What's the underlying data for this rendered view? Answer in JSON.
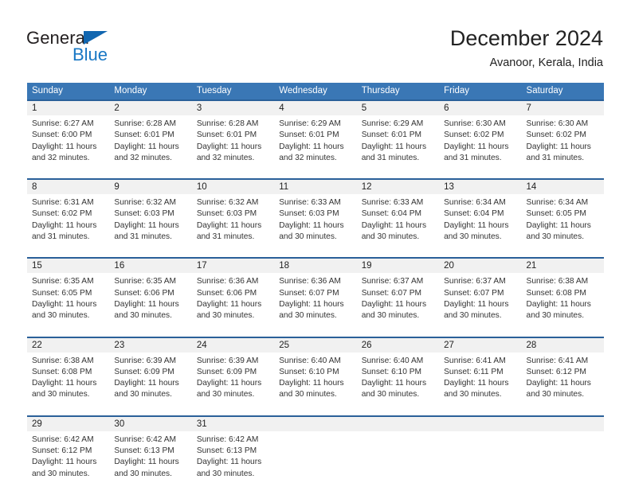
{
  "brand": {
    "name_top": "General",
    "name_bottom": "Blue",
    "triangle_color": "#1166b0",
    "blue_color": "#1877c4"
  },
  "header": {
    "title": "December 2024",
    "location": "Avanoor, Kerala, India"
  },
  "theme": {
    "header_blue": "#3a77b5",
    "row_border_blue": "#2a6099",
    "date_band_gray": "#f1f1f1"
  },
  "calendar": {
    "day_headers": [
      "Sunday",
      "Monday",
      "Tuesday",
      "Wednesday",
      "Thursday",
      "Friday",
      "Saturday"
    ],
    "weeks": [
      [
        {
          "day": "1",
          "sunrise": "Sunrise: 6:27 AM",
          "sunset": "Sunset: 6:00 PM",
          "daylight1": "Daylight: 11 hours",
          "daylight2": "and 32 minutes."
        },
        {
          "day": "2",
          "sunrise": "Sunrise: 6:28 AM",
          "sunset": "Sunset: 6:01 PM",
          "daylight1": "Daylight: 11 hours",
          "daylight2": "and 32 minutes."
        },
        {
          "day": "3",
          "sunrise": "Sunrise: 6:28 AM",
          "sunset": "Sunset: 6:01 PM",
          "daylight1": "Daylight: 11 hours",
          "daylight2": "and 32 minutes."
        },
        {
          "day": "4",
          "sunrise": "Sunrise: 6:29 AM",
          "sunset": "Sunset: 6:01 PM",
          "daylight1": "Daylight: 11 hours",
          "daylight2": "and 32 minutes."
        },
        {
          "day": "5",
          "sunrise": "Sunrise: 6:29 AM",
          "sunset": "Sunset: 6:01 PM",
          "daylight1": "Daylight: 11 hours",
          "daylight2": "and 31 minutes."
        },
        {
          "day": "6",
          "sunrise": "Sunrise: 6:30 AM",
          "sunset": "Sunset: 6:02 PM",
          "daylight1": "Daylight: 11 hours",
          "daylight2": "and 31 minutes."
        },
        {
          "day": "7",
          "sunrise": "Sunrise: 6:30 AM",
          "sunset": "Sunset: 6:02 PM",
          "daylight1": "Daylight: 11 hours",
          "daylight2": "and 31 minutes."
        }
      ],
      [
        {
          "day": "8",
          "sunrise": "Sunrise: 6:31 AM",
          "sunset": "Sunset: 6:02 PM",
          "daylight1": "Daylight: 11 hours",
          "daylight2": "and 31 minutes."
        },
        {
          "day": "9",
          "sunrise": "Sunrise: 6:32 AM",
          "sunset": "Sunset: 6:03 PM",
          "daylight1": "Daylight: 11 hours",
          "daylight2": "and 31 minutes."
        },
        {
          "day": "10",
          "sunrise": "Sunrise: 6:32 AM",
          "sunset": "Sunset: 6:03 PM",
          "daylight1": "Daylight: 11 hours",
          "daylight2": "and 31 minutes."
        },
        {
          "day": "11",
          "sunrise": "Sunrise: 6:33 AM",
          "sunset": "Sunset: 6:03 PM",
          "daylight1": "Daylight: 11 hours",
          "daylight2": "and 30 minutes."
        },
        {
          "day": "12",
          "sunrise": "Sunrise: 6:33 AM",
          "sunset": "Sunset: 6:04 PM",
          "daylight1": "Daylight: 11 hours",
          "daylight2": "and 30 minutes."
        },
        {
          "day": "13",
          "sunrise": "Sunrise: 6:34 AM",
          "sunset": "Sunset: 6:04 PM",
          "daylight1": "Daylight: 11 hours",
          "daylight2": "and 30 minutes."
        },
        {
          "day": "14",
          "sunrise": "Sunrise: 6:34 AM",
          "sunset": "Sunset: 6:05 PM",
          "daylight1": "Daylight: 11 hours",
          "daylight2": "and 30 minutes."
        }
      ],
      [
        {
          "day": "15",
          "sunrise": "Sunrise: 6:35 AM",
          "sunset": "Sunset: 6:05 PM",
          "daylight1": "Daylight: 11 hours",
          "daylight2": "and 30 minutes."
        },
        {
          "day": "16",
          "sunrise": "Sunrise: 6:35 AM",
          "sunset": "Sunset: 6:06 PM",
          "daylight1": "Daylight: 11 hours",
          "daylight2": "and 30 minutes."
        },
        {
          "day": "17",
          "sunrise": "Sunrise: 6:36 AM",
          "sunset": "Sunset: 6:06 PM",
          "daylight1": "Daylight: 11 hours",
          "daylight2": "and 30 minutes."
        },
        {
          "day": "18",
          "sunrise": "Sunrise: 6:36 AM",
          "sunset": "Sunset: 6:07 PM",
          "daylight1": "Daylight: 11 hours",
          "daylight2": "and 30 minutes."
        },
        {
          "day": "19",
          "sunrise": "Sunrise: 6:37 AM",
          "sunset": "Sunset: 6:07 PM",
          "daylight1": "Daylight: 11 hours",
          "daylight2": "and 30 minutes."
        },
        {
          "day": "20",
          "sunrise": "Sunrise: 6:37 AM",
          "sunset": "Sunset: 6:07 PM",
          "daylight1": "Daylight: 11 hours",
          "daylight2": "and 30 minutes."
        },
        {
          "day": "21",
          "sunrise": "Sunrise: 6:38 AM",
          "sunset": "Sunset: 6:08 PM",
          "daylight1": "Daylight: 11 hours",
          "daylight2": "and 30 minutes."
        }
      ],
      [
        {
          "day": "22",
          "sunrise": "Sunrise: 6:38 AM",
          "sunset": "Sunset: 6:08 PM",
          "daylight1": "Daylight: 11 hours",
          "daylight2": "and 30 minutes."
        },
        {
          "day": "23",
          "sunrise": "Sunrise: 6:39 AM",
          "sunset": "Sunset: 6:09 PM",
          "daylight1": "Daylight: 11 hours",
          "daylight2": "and 30 minutes."
        },
        {
          "day": "24",
          "sunrise": "Sunrise: 6:39 AM",
          "sunset": "Sunset: 6:09 PM",
          "daylight1": "Daylight: 11 hours",
          "daylight2": "and 30 minutes."
        },
        {
          "day": "25",
          "sunrise": "Sunrise: 6:40 AM",
          "sunset": "Sunset: 6:10 PM",
          "daylight1": "Daylight: 11 hours",
          "daylight2": "and 30 minutes."
        },
        {
          "day": "26",
          "sunrise": "Sunrise: 6:40 AM",
          "sunset": "Sunset: 6:10 PM",
          "daylight1": "Daylight: 11 hours",
          "daylight2": "and 30 minutes."
        },
        {
          "day": "27",
          "sunrise": "Sunrise: 6:41 AM",
          "sunset": "Sunset: 6:11 PM",
          "daylight1": "Daylight: 11 hours",
          "daylight2": "and 30 minutes."
        },
        {
          "day": "28",
          "sunrise": "Sunrise: 6:41 AM",
          "sunset": "Sunset: 6:12 PM",
          "daylight1": "Daylight: 11 hours",
          "daylight2": "and 30 minutes."
        }
      ],
      [
        {
          "day": "29",
          "sunrise": "Sunrise: 6:42 AM",
          "sunset": "Sunset: 6:12 PM",
          "daylight1": "Daylight: 11 hours",
          "daylight2": "and 30 minutes."
        },
        {
          "day": "30",
          "sunrise": "Sunrise: 6:42 AM",
          "sunset": "Sunset: 6:13 PM",
          "daylight1": "Daylight: 11 hours",
          "daylight2": "and 30 minutes."
        },
        {
          "day": "31",
          "sunrise": "Sunrise: 6:42 AM",
          "sunset": "Sunset: 6:13 PM",
          "daylight1": "Daylight: 11 hours",
          "daylight2": "and 30 minutes."
        },
        {
          "day": "",
          "sunrise": "",
          "sunset": "",
          "daylight1": "",
          "daylight2": ""
        },
        {
          "day": "",
          "sunrise": "",
          "sunset": "",
          "daylight1": "",
          "daylight2": ""
        },
        {
          "day": "",
          "sunrise": "",
          "sunset": "",
          "daylight1": "",
          "daylight2": ""
        },
        {
          "day": "",
          "sunrise": "",
          "sunset": "",
          "daylight1": "",
          "daylight2": ""
        }
      ]
    ]
  }
}
